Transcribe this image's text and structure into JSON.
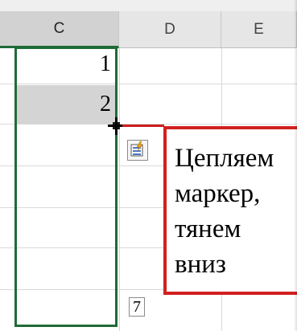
{
  "columns": [
    {
      "label": "C",
      "selected": true
    },
    {
      "label": "D",
      "selected": false
    },
    {
      "label": "E",
      "selected": false
    }
  ],
  "cells": {
    "c1": "1",
    "c2": "2"
  },
  "autofill_options_icon": "autofill-options-icon",
  "fill_tooltip": "7",
  "callout": {
    "text": "Цепляем\nмаркер,\nтянем\nвниз"
  },
  "colors": {
    "selection": "#1f6b37",
    "callout_border": "#d22020",
    "selected_cell_fill": "#d4d4d4"
  }
}
